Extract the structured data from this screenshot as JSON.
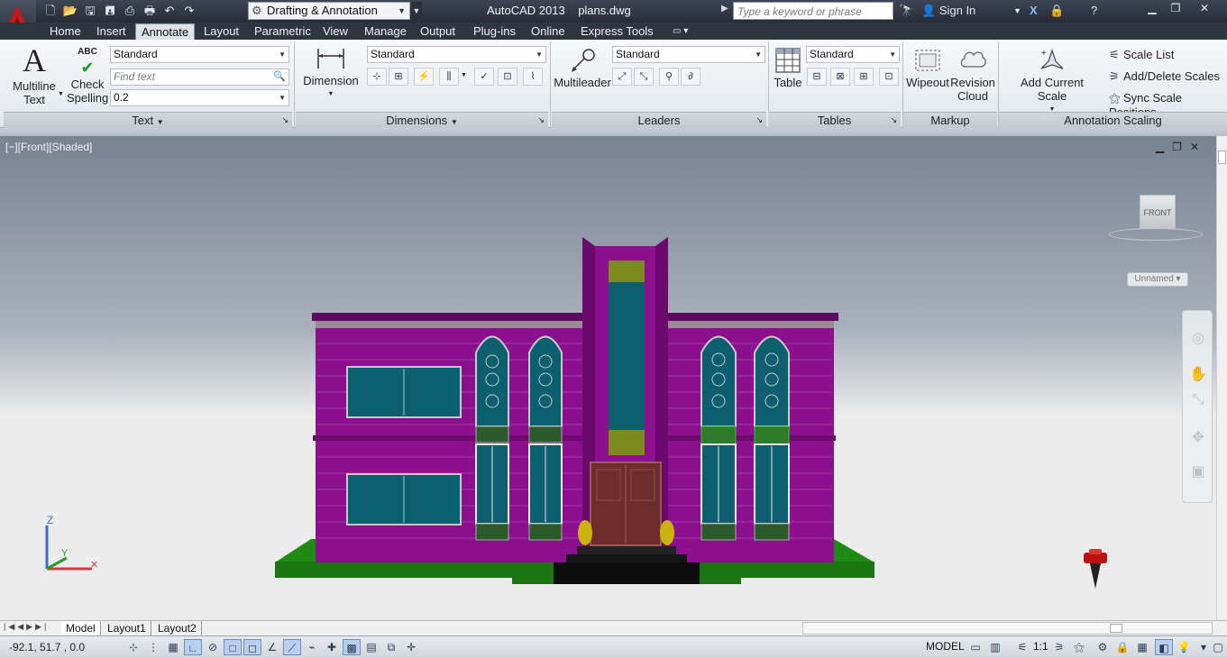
{
  "titlebar": {
    "app_name": "AutoCAD 2013",
    "file_name": "plans.dwg",
    "workspace": "Drafting & Annotation",
    "search_placeholder": "Type a keyword or phrase",
    "sign_in": "Sign In"
  },
  "tabs": [
    {
      "label": "Home"
    },
    {
      "label": "Insert"
    },
    {
      "label": "Annotate",
      "active": true
    },
    {
      "label": "Layout"
    },
    {
      "label": "Parametric"
    },
    {
      "label": "View"
    },
    {
      "label": "Manage"
    },
    {
      "label": "Output"
    },
    {
      "label": "Plug-ins"
    },
    {
      "label": "Online"
    },
    {
      "label": "Express Tools"
    }
  ],
  "ribbon": {
    "text_panel": {
      "title": "Text",
      "multiline_text": "Multiline\nText",
      "check_spelling": "Check\nSpelling",
      "style_value": "Standard",
      "find_placeholder": "Find text",
      "height_value": "0.2"
    },
    "dimensions_panel": {
      "title": "Dimensions",
      "dimension": "Dimension",
      "style_value": "Standard"
    },
    "leaders_panel": {
      "title": "Leaders",
      "multileader": "Multileader",
      "style_value": "Standard"
    },
    "tables_panel": {
      "title": "Tables",
      "table": "Table",
      "style_value": "Standard"
    },
    "markup_panel": {
      "title": "Markup",
      "wipeout": "Wipeout",
      "revision_cloud": "Revision\nCloud"
    },
    "annotation_scaling_panel": {
      "title": "Annotation Scaling",
      "add_current_scale": "Add Current Scale",
      "scale_list": "Scale List",
      "add_delete_scales": "Add/Delete Scales",
      "sync_scale_positions": "Sync Scale Positions"
    }
  },
  "viewport": {
    "label": "[−][Front][Shaded]",
    "viewcube_face": "FRONT",
    "ucs_name": "Unnamed",
    "ucs_axis_z": "Z",
    "ucs_axis_y": "Y"
  },
  "layout_tabs": [
    {
      "label": "Model",
      "active": true
    },
    {
      "label": "Layout1"
    },
    {
      "label": "Layout2"
    }
  ],
  "statusbar": {
    "coords": "-92.1, 51.7 , 0.0",
    "model_label": "MODEL",
    "scale": "1:1"
  },
  "colors": {
    "building": "#8c0f8e",
    "window_glass": "#0c5f6f",
    "lawn": "#1f8a14",
    "accent_tab": "#dfe3e8"
  }
}
